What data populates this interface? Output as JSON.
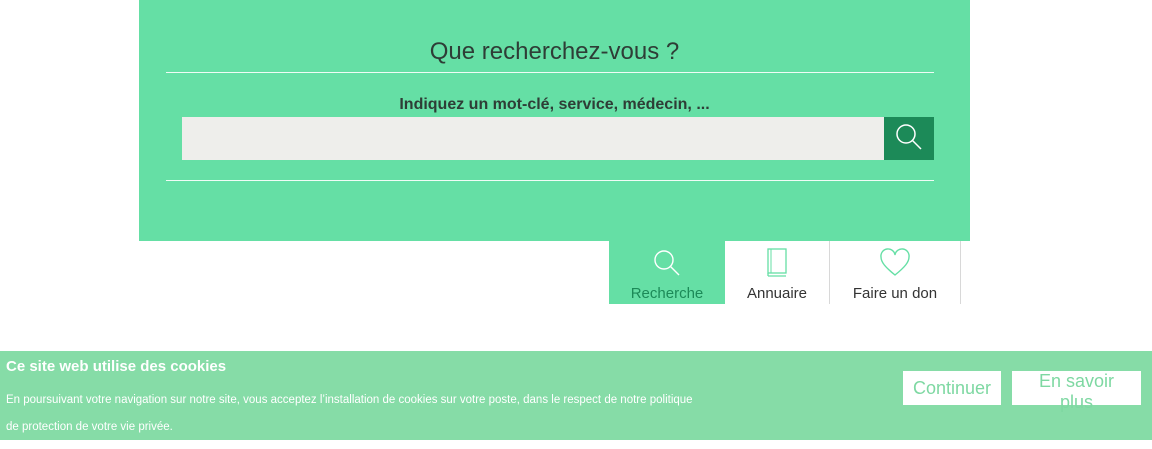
{
  "search": {
    "title": "Que recherchez-vous ?",
    "label": "Indiquez un mot-clé, service, médecin, ...",
    "input_value": "",
    "placeholder": ""
  },
  "tabs": [
    {
      "label": "Recherche",
      "icon": "search-icon",
      "active": true
    },
    {
      "label": "Annuaire",
      "icon": "book-icon",
      "active": false
    },
    {
      "label": "Faire un don",
      "icon": "heart-icon",
      "active": false
    }
  ],
  "cookies": {
    "title": "Ce site web utilise des cookies",
    "text": "En poursuivant votre navigation sur notre site, vous acceptez l’installation de cookies sur votre poste, dans le respect de notre politique de protection de votre vie privée.",
    "continue_label": "Continuer",
    "more_label": "En savoir plus"
  },
  "colors": {
    "panel": "#65dfa5",
    "accent_dark": "#1c8a58",
    "cookie_bar": "#86dca7",
    "icon_green": "#65dfa5"
  }
}
